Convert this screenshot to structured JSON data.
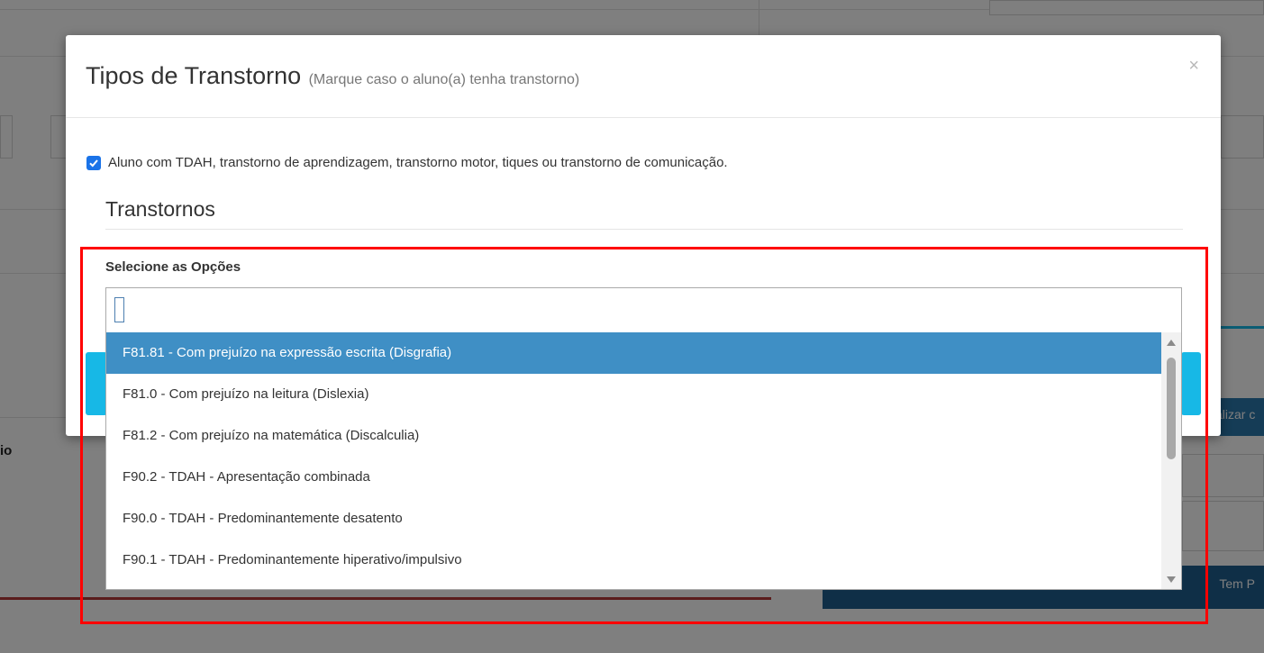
{
  "background": {
    "stub_left_text": "io",
    "stub_right_blue_text": "alizar c",
    "stub_right_dark_text": "Tem P"
  },
  "modal": {
    "title": "Tipos de Transtorno",
    "subtitle": "(Marque caso o aluno(a) tenha transtorno)",
    "close_label": "×",
    "checkbox": {
      "checked": true,
      "label": "Aluno com TDAH, transtorno de aprendizagem, transtorno motor, tiques ou transtorno de comunicação."
    },
    "section_title": "Transtornos",
    "field_label": "Selecione as Opções",
    "search_value": ""
  },
  "dropdown": {
    "options": [
      {
        "label": "F81.81 - Com prejuízo na expressão escrita (Disgrafia)",
        "highlighted": true
      },
      {
        "label": "F81.0 - Com prejuízo na leitura (Dislexia)",
        "highlighted": false
      },
      {
        "label": "F81.2 - Com prejuízo na matemática (Discalculia)",
        "highlighted": false
      },
      {
        "label": "F90.2 - TDAH - Apresentação combinada",
        "highlighted": false
      },
      {
        "label": "F90.0 - TDAH - Predominantemente desatento",
        "highlighted": false
      },
      {
        "label": "F90.1 - TDAH - Predominantemente hiperativo/impulsivo",
        "highlighted": false
      }
    ]
  },
  "colors": {
    "highlight_option": "#3f8fc5",
    "checkbox": "#1a73e8",
    "annotation_frame": "#ff0000",
    "overlay": "rgba(0,0,0,0.5)"
  }
}
